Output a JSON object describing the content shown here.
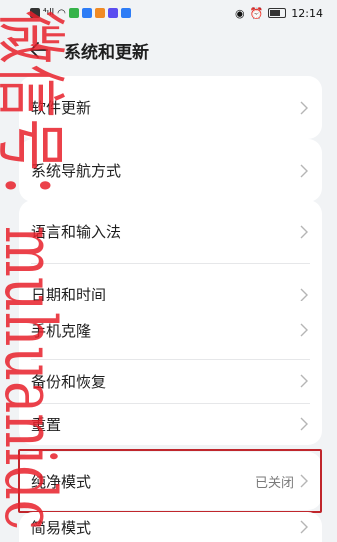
{
  "status_bar": {
    "time": "12:14",
    "left_icons": [
      "message-icon",
      "signal-icon",
      "wifi-icon",
      "app-icon",
      "app-icon",
      "app-icon",
      "app-icon",
      "app-icon"
    ],
    "right_icons": [
      "eye-icon",
      "alarm-icon",
      "battery-icon"
    ]
  },
  "header": {
    "title": "系统和更新"
  },
  "groups": [
    {
      "items": [
        {
          "label": "软件更新",
          "value": ""
        }
      ]
    },
    {
      "items": [
        {
          "label": "系统导航方式",
          "value": ""
        }
      ]
    },
    {
      "items": [
        {
          "label": "语言和输入法",
          "value": ""
        },
        {
          "label": "日期和时间",
          "value": ""
        }
      ]
    },
    {
      "items": [
        {
          "label": "手机克隆",
          "value": ""
        },
        {
          "label": "备份和恢复",
          "value": ""
        },
        {
          "label": "重置",
          "value": ""
        }
      ]
    },
    {
      "items": [
        {
          "label": "纯净模式",
          "value": "已关闭"
        }
      ]
    },
    {
      "items": [
        {
          "label": "简易模式",
          "value": ""
        }
      ]
    }
  ],
  "watermark": {
    "text": "微信号：muhuanidc"
  },
  "colors": {
    "highlight": "#c0262c",
    "watermark": "#e8202a"
  }
}
